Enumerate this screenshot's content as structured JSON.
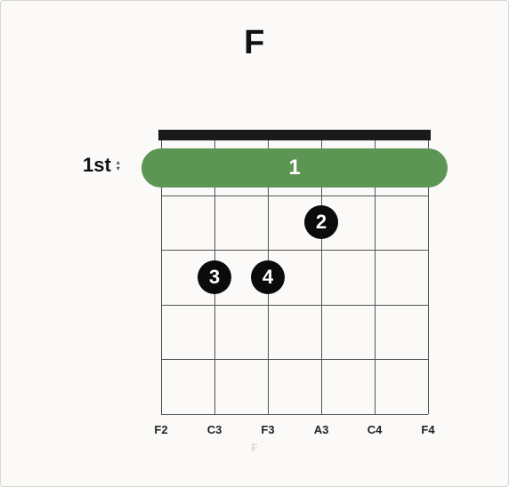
{
  "chord": {
    "name": "F",
    "footer_label": "F",
    "start_fret_label": "1st",
    "num_frets": 5,
    "num_strings": 6,
    "string_notes": [
      "F2",
      "C3",
      "F3",
      "A3",
      "C4",
      "F4"
    ],
    "barre": {
      "finger": "1",
      "fret": 1,
      "from_string": 0,
      "to_string": 5
    },
    "dots": [
      {
        "finger": "2",
        "fret": 2,
        "string": 3
      },
      {
        "finger": "3",
        "fret": 3,
        "string": 1
      },
      {
        "finger": "4",
        "fret": 3,
        "string": 2
      }
    ],
    "colors": {
      "barre": "#5d9654",
      "dot": "#0b0b0b"
    }
  }
}
